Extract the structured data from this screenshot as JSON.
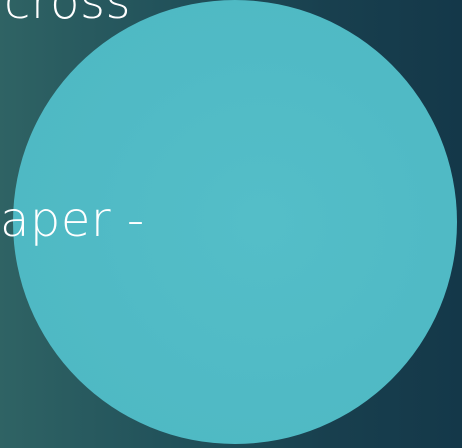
{
  "slide": {
    "text_lines": [
      "cross",
      "aper -"
    ],
    "colors": {
      "background_left": "#2f6364",
      "background_right": "#143849",
      "circle_fill": "#50bac5",
      "text": "#ffffff"
    }
  }
}
